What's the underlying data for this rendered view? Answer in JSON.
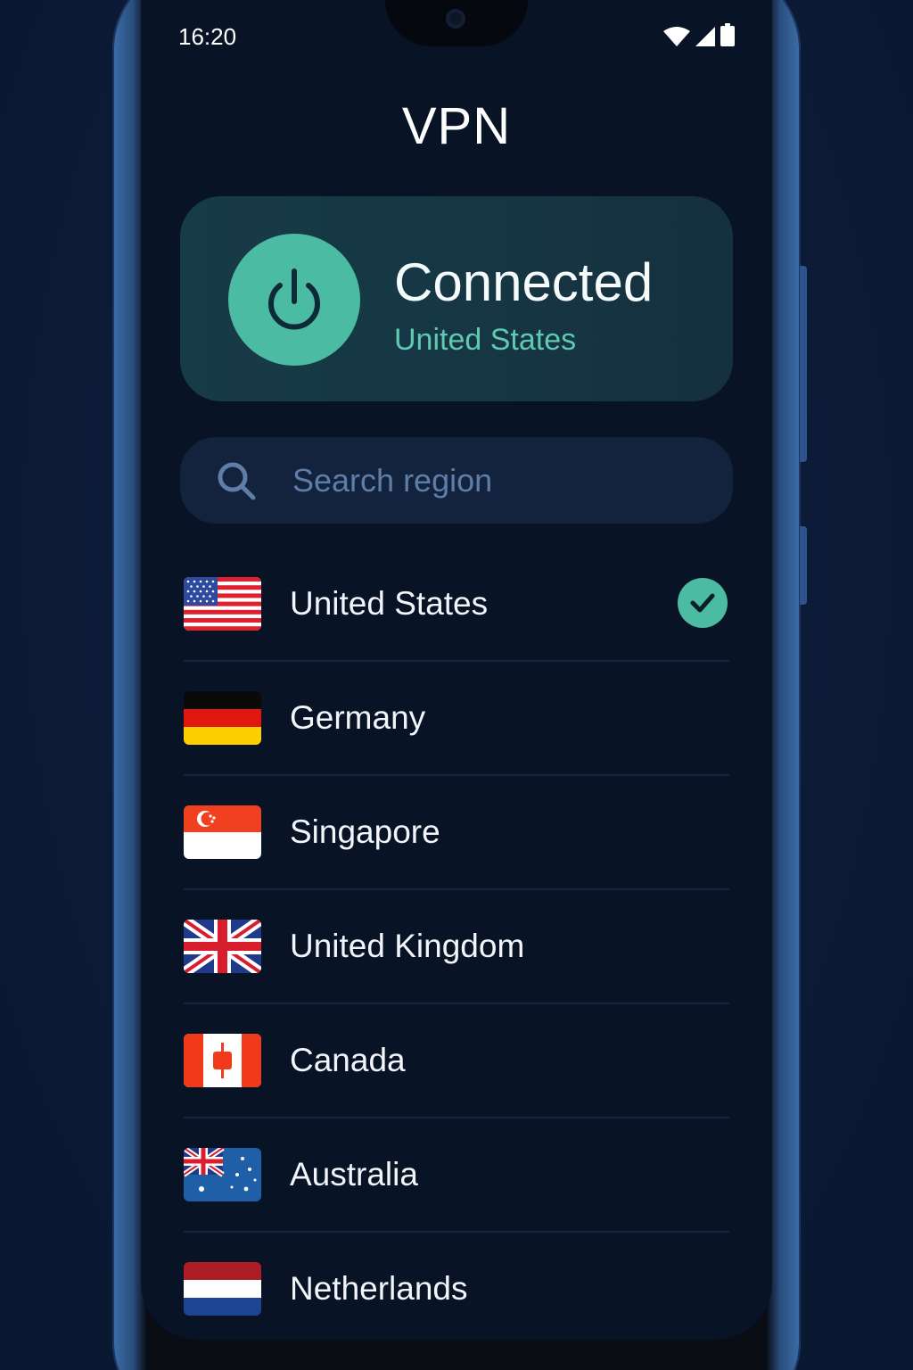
{
  "status_bar": {
    "time": "16:20",
    "icons": [
      "wifi-icon",
      "cellular-signal-icon",
      "battery-icon"
    ]
  },
  "header": {
    "title": "VPN"
  },
  "connection": {
    "status": "Connected",
    "region": "United States",
    "button_icon": "power-icon",
    "accent_color": "#4cbba3"
  },
  "search": {
    "placeholder": "Search region",
    "value": "",
    "icon": "search-icon"
  },
  "regions": [
    {
      "name": "United States",
      "flag": "us-flag-icon",
      "selected": true
    },
    {
      "name": "Germany",
      "flag": "germany-flag-icon",
      "selected": false
    },
    {
      "name": "Singapore",
      "flag": "singapore-flag-icon",
      "selected": false
    },
    {
      "name": "United Kingdom",
      "flag": "uk-flag-icon",
      "selected": false
    },
    {
      "name": "Canada",
      "flag": "canada-flag-icon",
      "selected": false
    },
    {
      "name": "Australia",
      "flag": "australia-flag-icon",
      "selected": false
    },
    {
      "name": "Netherlands",
      "flag": "netherlands-flag-icon",
      "selected": false
    }
  ],
  "colors": {
    "background": "#091326",
    "card": "#163644",
    "search_field": "#13223d",
    "text": "#f2f5fa",
    "accent": "#4cbba3"
  }
}
